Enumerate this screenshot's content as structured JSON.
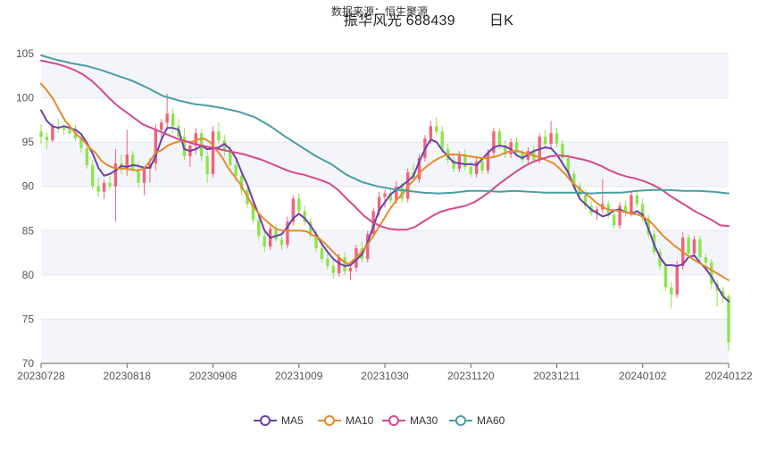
{
  "header": {
    "source": "数据来源：恒生聚源",
    "title": "振华风光 688439",
    "period": "日K"
  },
  "chart_data": {
    "type": "candlestick",
    "title": "振华风光 688439 日K",
    "ylim": [
      70,
      105
    ],
    "yticks": [
      70,
      75,
      80,
      85,
      90,
      95,
      100,
      105
    ],
    "xticks": [
      "20230728",
      "20230818",
      "20230908",
      "20231009",
      "20231030",
      "20231120",
      "20231211",
      "20240102",
      "20240122"
    ],
    "xtick_index": [
      0,
      15,
      30,
      45,
      60,
      75,
      90,
      105,
      120
    ],
    "grid": "horizontal",
    "legend_position": "bottom",
    "up_color": "#f0637a",
    "down_color": "#8ce54a",
    "candles_ohlc": [
      [
        96.2,
        97.0,
        94.8,
        95.6
      ],
      [
        95.6,
        96.1,
        94.2,
        95.2
      ],
      [
        95.2,
        97.1,
        95.0,
        96.8
      ],
      [
        96.8,
        97.6,
        96.0,
        96.6
      ],
      [
        96.6,
        97.0,
        95.8,
        96.4
      ],
      [
        96.4,
        97.2,
        95.9,
        96.0
      ],
      [
        96.0,
        96.9,
        95.1,
        95.4
      ],
      [
        95.4,
        96.0,
        93.8,
        94.3
      ],
      [
        94.3,
        94.9,
        92.0,
        92.4
      ],
      [
        92.4,
        93.0,
        89.6,
        90.0
      ],
      [
        90.0,
        91.0,
        88.8,
        89.4
      ],
      [
        89.4,
        90.8,
        88.6,
        90.4
      ],
      [
        90.4,
        91.2,
        89.6,
        90.0
      ],
      [
        90.0,
        94.2,
        86.0,
        92.6
      ],
      [
        92.6,
        93.6,
        91.4,
        92.0
      ],
      [
        92.0,
        96.4,
        91.2,
        93.6
      ],
      [
        93.6,
        94.0,
        91.6,
        91.8
      ],
      [
        91.8,
        92.8,
        89.8,
        90.4
      ],
      [
        90.4,
        92.2,
        89.0,
        92.0
      ],
      [
        92.0,
        93.2,
        90.4,
        92.6
      ],
      [
        92.6,
        97.0,
        91.8,
        96.4
      ],
      [
        96.4,
        97.6,
        95.0,
        97.2
      ],
      [
        97.2,
        100.5,
        96.4,
        98.2
      ],
      [
        98.2,
        98.8,
        96.0,
        96.8
      ],
      [
        96.8,
        97.6,
        95.2,
        95.6
      ],
      [
        95.6,
        96.6,
        93.0,
        93.4
      ],
      [
        93.4,
        94.8,
        92.2,
        94.6
      ],
      [
        94.6,
        96.6,
        93.6,
        96.0
      ],
      [
        96.0,
        96.4,
        92.8,
        93.4
      ],
      [
        93.4,
        94.0,
        90.4,
        91.4
      ],
      [
        91.4,
        96.8,
        91.0,
        96.2
      ],
      [
        96.2,
        97.2,
        94.8,
        95.2
      ],
      [
        95.2,
        95.8,
        93.4,
        94.0
      ],
      [
        94.0,
        94.6,
        92.2,
        92.4
      ],
      [
        92.4,
        93.0,
        90.6,
        91.2
      ],
      [
        91.2,
        91.8,
        89.0,
        89.6
      ],
      [
        89.6,
        90.2,
        87.6,
        88.0
      ],
      [
        88.0,
        88.4,
        85.8,
        86.2
      ],
      [
        86.2,
        86.6,
        84.0,
        84.4
      ],
      [
        84.4,
        84.8,
        82.6,
        83.2
      ],
      [
        83.2,
        85.6,
        82.8,
        85.2
      ],
      [
        85.2,
        85.8,
        83.8,
        84.0
      ],
      [
        84.0,
        84.4,
        82.8,
        83.4
      ],
      [
        83.4,
        86.6,
        83.0,
        86.0
      ],
      [
        86.0,
        89.0,
        85.6,
        88.6
      ],
      [
        88.6,
        89.2,
        86.8,
        87.2
      ],
      [
        87.2,
        87.8,
        85.6,
        86.0
      ],
      [
        86.0,
        86.4,
        84.2,
        84.6
      ],
      [
        84.6,
        85.0,
        82.6,
        83.0
      ],
      [
        83.0,
        83.4,
        81.4,
        81.8
      ],
      [
        81.8,
        82.4,
        80.6,
        81.0
      ],
      [
        81.0,
        81.6,
        79.6,
        80.2
      ],
      [
        80.2,
        82.4,
        79.8,
        82.0
      ],
      [
        82.0,
        82.6,
        80.0,
        80.4
      ],
      [
        80.4,
        81.2,
        79.4,
        80.8
      ],
      [
        80.8,
        83.4,
        80.4,
        83.0
      ],
      [
        83.0,
        83.8,
        81.4,
        81.8
      ],
      [
        81.8,
        85.0,
        81.4,
        84.6
      ],
      [
        84.6,
        87.6,
        84.2,
        87.2
      ],
      [
        87.2,
        89.4,
        86.6,
        88.8
      ],
      [
        88.8,
        89.6,
        87.6,
        89.2
      ],
      [
        89.2,
        89.8,
        88.0,
        88.4
      ],
      [
        88.4,
        90.6,
        88.0,
        90.0
      ],
      [
        90.0,
        90.4,
        88.2,
        88.6
      ],
      [
        88.6,
        92.0,
        88.2,
        91.6
      ],
      [
        91.6,
        92.6,
        90.6,
        90.8
      ],
      [
        90.8,
        93.6,
        90.4,
        93.2
      ],
      [
        93.2,
        95.8,
        92.8,
        95.4
      ],
      [
        95.4,
        97.4,
        94.8,
        96.8
      ],
      [
        96.8,
        97.8,
        95.8,
        96.2
      ],
      [
        96.2,
        96.8,
        93.8,
        94.2
      ],
      [
        94.2,
        94.8,
        92.6,
        93.0
      ],
      [
        93.0,
        93.6,
        91.6,
        92.0
      ],
      [
        92.0,
        94.0,
        91.6,
        93.6
      ],
      [
        93.6,
        94.2,
        91.8,
        92.2
      ],
      [
        92.2,
        92.8,
        91.0,
        91.4
      ],
      [
        91.4,
        93.4,
        91.0,
        92.8
      ],
      [
        92.8,
        93.2,
        91.4,
        91.8
      ],
      [
        91.8,
        94.2,
        91.4,
        93.8
      ],
      [
        93.8,
        96.6,
        93.2,
        96.2
      ],
      [
        96.2,
        96.6,
        94.2,
        94.6
      ],
      [
        94.6,
        95.2,
        93.2,
        93.6
      ],
      [
        93.6,
        95.4,
        93.2,
        95.0
      ],
      [
        95.0,
        95.6,
        93.4,
        93.8
      ],
      [
        93.8,
        94.2,
        92.6,
        93.0
      ],
      [
        93.0,
        94.4,
        92.6,
        94.0
      ],
      [
        94.0,
        94.6,
        92.6,
        93.0
      ],
      [
        93.0,
        96.0,
        92.6,
        95.6
      ],
      [
        95.6,
        96.4,
        94.4,
        94.8
      ],
      [
        94.8,
        97.4,
        94.2,
        96.0
      ],
      [
        96.0,
        96.6,
        94.4,
        94.8
      ],
      [
        94.8,
        95.2,
        92.8,
        93.2
      ],
      [
        93.2,
        93.6,
        91.0,
        91.4
      ],
      [
        91.4,
        91.8,
        89.6,
        90.0
      ],
      [
        90.0,
        90.4,
        88.6,
        89.0
      ],
      [
        89.0,
        89.6,
        87.4,
        87.8
      ],
      [
        87.8,
        88.4,
        86.6,
        87.0
      ],
      [
        87.0,
        87.8,
        86.2,
        87.4
      ],
      [
        87.4,
        90.8,
        87.0,
        88.0
      ],
      [
        88.0,
        88.4,
        86.4,
        86.8
      ],
      [
        86.8,
        87.2,
        85.2,
        85.6
      ],
      [
        85.6,
        88.2,
        85.2,
        87.8
      ],
      [
        87.8,
        88.4,
        86.6,
        87.0
      ],
      [
        87.0,
        89.4,
        86.6,
        89.0
      ],
      [
        89.0,
        89.6,
        87.6,
        88.0
      ],
      [
        88.0,
        88.6,
        86.0,
        86.4
      ],
      [
        86.4,
        86.8,
        84.2,
        84.6
      ],
      [
        84.6,
        85.0,
        82.2,
        82.6
      ],
      [
        82.6,
        83.0,
        80.6,
        81.0
      ],
      [
        81.0,
        81.4,
        78.2,
        78.6
      ],
      [
        78.6,
        79.2,
        76.2,
        77.8
      ],
      [
        77.8,
        81.6,
        77.4,
        81.0
      ],
      [
        81.0,
        84.8,
        80.6,
        84.2
      ],
      [
        84.2,
        84.6,
        82.0,
        82.4
      ],
      [
        82.4,
        84.4,
        82.0,
        84.0
      ],
      [
        84.0,
        84.4,
        81.6,
        82.0
      ],
      [
        82.0,
        82.4,
        80.8,
        81.4
      ],
      [
        81.4,
        81.8,
        78.4,
        79.0
      ],
      [
        79.0,
        79.4,
        76.4,
        78.2
      ],
      [
        78.2,
        78.6,
        76.8,
        77.6
      ],
      [
        77.6,
        77.8,
        71.4,
        72.4
      ]
    ],
    "series": [
      {
        "name": "MA5",
        "color": "#6a3fae",
        "values": [
          98.6,
          97.4,
          96.8,
          96.6,
          96.8,
          96.6,
          96.4,
          95.9,
          94.9,
          93.7,
          92.1,
          91.2,
          91.4,
          91.8,
          92.3,
          92.2,
          92.4,
          92.3,
          92.1,
          92.1,
          93.4,
          95.3,
          96.6,
          96.6,
          96.4,
          94.2,
          94.0,
          94.2,
          94.6,
          94.2,
          94.3,
          94.4,
          94.8,
          94.2,
          93.2,
          91.6,
          90.2,
          88.4,
          86.8,
          85.0,
          84.2,
          84.4,
          84.6,
          85.4,
          86.4,
          86.9,
          86.4,
          85.6,
          84.6,
          83.5,
          82.6,
          81.8,
          81.3,
          81.0,
          81.1,
          81.7,
          82.3,
          83.7,
          85.5,
          87.3,
          88.2,
          89.1,
          89.6,
          90.1,
          90.6,
          91.2,
          92.8,
          94.2,
          95.3,
          95.0,
          94.1,
          93.4,
          92.7,
          92.6,
          92.5,
          92.5,
          92.4,
          93.1,
          93.8,
          94.4,
          94.6,
          94.5,
          94.2,
          93.5,
          93.2,
          93.6,
          94.0,
          94.2,
          94.4,
          94.3,
          93.6,
          92.6,
          91.6,
          90.0,
          88.6,
          88.0,
          87.4,
          87.0,
          86.6,
          86.8,
          87.3,
          87.4,
          87.1,
          86.9,
          87.2,
          86.8,
          85.2,
          83.4,
          82.0,
          81.1,
          81.1,
          81.0,
          81.2,
          82.0,
          82.2,
          81.4,
          80.7,
          79.8,
          78.7,
          77.6,
          77.0
        ]
      },
      {
        "name": "MA10",
        "color": "#e58a2e",
        "values": [
          101.6,
          100.8,
          99.9,
          98.6,
          97.4,
          96.6,
          95.8,
          95.2,
          94.4,
          93.8,
          92.9,
          92.4,
          92.1,
          92.0,
          92.0,
          91.9,
          91.8,
          92.0,
          92.8,
          93.8,
          94.1,
          94.6,
          94.9,
          95.1,
          95.1,
          95.0,
          95.3,
          95.4,
          95.0,
          94.2,
          93.3,
          92.1,
          91.2,
          90.3,
          89.1,
          87.9,
          87.0,
          86.3,
          85.7,
          85.2,
          85.0,
          85.0,
          85.0,
          85.0,
          84.9,
          84.5,
          84.2,
          83.6,
          82.9,
          82.2,
          81.6,
          81.2,
          81.8,
          82.5,
          83.3,
          84.3,
          85.4,
          86.5,
          87.6,
          88.5,
          89.2,
          90.1,
          90.9,
          91.7,
          92.3,
          92.8,
          93.2,
          93.5,
          93.6,
          93.6,
          93.5,
          93.4,
          93.3,
          93.2,
          93.2,
          93.3,
          93.5,
          93.8,
          94.0,
          94.0,
          93.8,
          93.6,
          93.4,
          93.2,
          92.9,
          92.6,
          92.0,
          91.3,
          90.5,
          89.9,
          89.3,
          88.8,
          88.2,
          87.7,
          87.4,
          87.3,
          87.2,
          87.1,
          86.9,
          86.8,
          86.5,
          86.0,
          85.3,
          84.5,
          83.9,
          83.3,
          82.8,
          82.3,
          81.8,
          81.4,
          81.0,
          80.6,
          80.2,
          79.8,
          79.4
        ]
      },
      {
        "name": "MA30",
        "color": "#d6498f",
        "values": [
          104.2,
          104.0,
          103.8,
          103.5,
          103.1,
          102.6,
          101.9,
          101.0,
          100.0,
          99.1,
          98.4,
          97.7,
          97.0,
          96.6,
          96.2,
          95.8,
          95.4,
          95.1,
          94.8,
          94.6,
          94.4,
          94.2,
          94.0,
          93.8,
          93.6,
          93.3,
          93.0,
          92.6,
          92.2,
          91.8,
          91.5,
          91.3,
          91.0,
          90.7,
          90.3,
          89.6,
          88.6,
          87.7,
          86.7,
          86.0,
          85.5,
          85.2,
          85.1,
          85.1,
          85.4,
          86.0,
          86.6,
          87.1,
          87.4,
          87.6,
          87.8,
          88.2,
          88.8,
          89.5,
          90.3,
          91.0,
          91.7,
          92.3,
          92.8,
          93.1,
          93.4,
          93.5,
          93.4,
          93.2,
          93.0,
          92.7,
          92.3,
          91.8,
          91.4,
          91.1,
          90.9,
          90.6,
          90.2,
          89.7,
          89.0,
          88.4,
          87.8,
          87.2,
          86.7,
          86.2,
          85.6,
          85.5
        ]
      },
      {
        "name": "MA60",
        "color": "#4a9da3",
        "values": [
          104.8,
          104.3,
          103.9,
          103.6,
          103.1,
          102.5,
          101.9,
          101.1,
          100.2,
          99.7,
          99.3,
          99.1,
          98.8,
          98.4,
          97.8,
          96.8,
          95.6,
          94.5,
          93.4,
          92.5,
          91.3,
          90.5,
          90.0,
          89.7,
          89.5,
          89.3,
          89.2,
          89.3,
          89.5,
          89.5,
          89.4,
          89.5,
          89.4,
          89.3,
          89.3,
          89.3,
          89.2,
          89.3,
          89.3,
          89.5,
          89.6,
          89.6,
          89.5,
          89.5,
          89.4,
          89.2
        ]
      }
    ]
  }
}
